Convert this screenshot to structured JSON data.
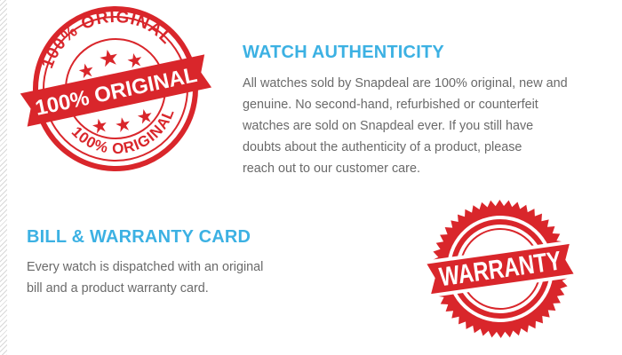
{
  "stamps": {
    "original": {
      "arc_top_text": "100% ORIGINAL",
      "arc_bottom_text": "100% ORIGINAL",
      "banner_text": "100% ORIGINAL",
      "color": "#d9262b"
    },
    "warranty": {
      "banner_text": "WARRANTY",
      "color": "#d9262b"
    }
  },
  "authenticity": {
    "title": "WATCH AUTHENTICITY",
    "lines": [
      "All watches sold by Snapdeal are 100% original, new and",
      "genuine. No second-hand, refurbished or counterfeit",
      "watches are sold on Snapdeal ever. If you still have",
      "doubts about the authenticity of a product, please",
      "reach out to our customer care."
    ]
  },
  "bill": {
    "title": "BILL & WARRANTY CARD",
    "lines": [
      "Every watch is dispatched with an original",
      "bill and a product warranty card."
    ]
  },
  "colors": {
    "heading": "#3cb1e3",
    "body_text": "#6a6a6a",
    "stamp_red": "#d9262b"
  }
}
